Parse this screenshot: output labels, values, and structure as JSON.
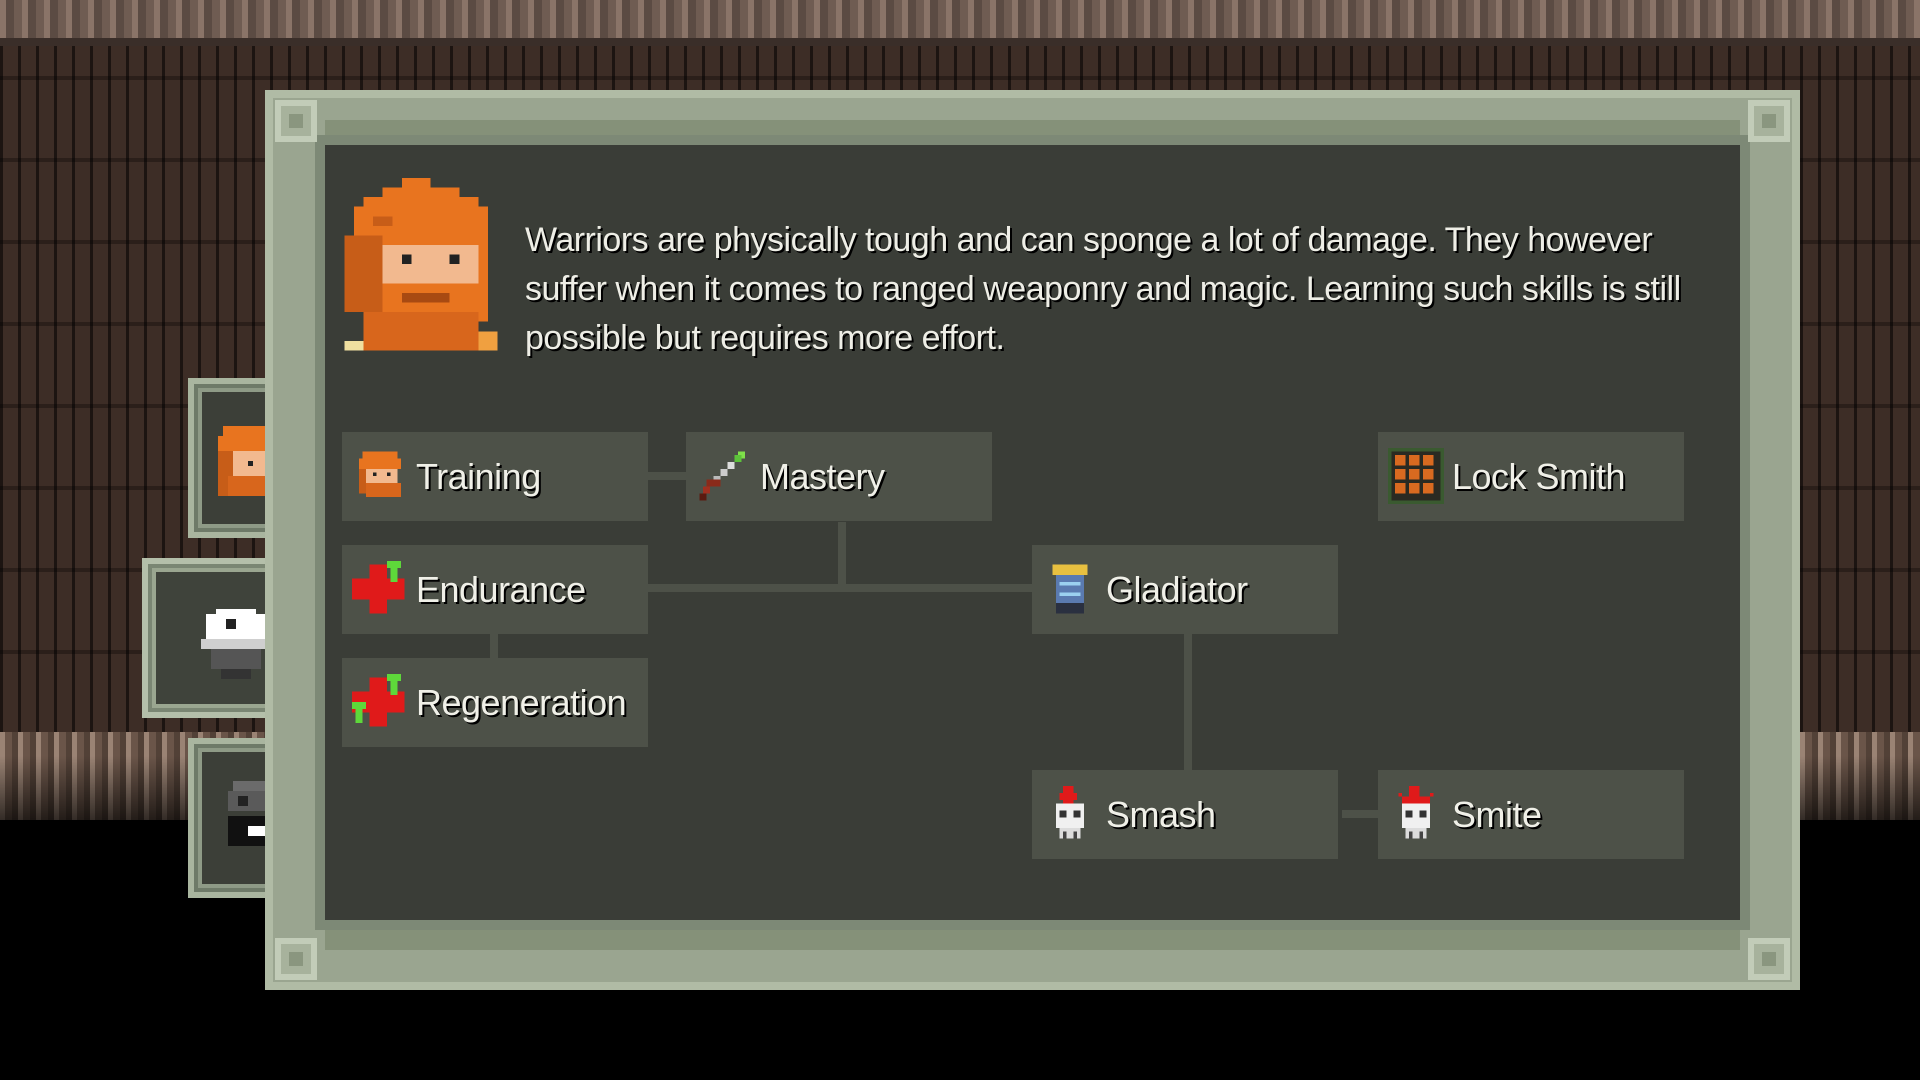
{
  "class": {
    "description": "Warriors are physically tough and can sponge a lot of damage. They however suffer when it comes to ranged weaponry and magic. Learning such skills is still possible but requires more effort.",
    "portrait_icon": "warrior-portrait-icon"
  },
  "class_tabs": [
    {
      "icon": "warrior-face-icon"
    },
    {
      "icon": "white-helmet-icon"
    },
    {
      "icon": "dark-helmet-icon"
    }
  ],
  "skills": {
    "training": {
      "label": "Training",
      "icon": "warrior-face-icon"
    },
    "mastery": {
      "label": "Mastery",
      "icon": "sword-icon"
    },
    "lock_smith": {
      "label": "Lock Smith",
      "icon": "grate-icon"
    },
    "endurance": {
      "label": "Endurance",
      "icon": "red-cross-up-icon"
    },
    "gladiator": {
      "label": "Gladiator",
      "icon": "armor-icon"
    },
    "regeneration": {
      "label": "Regeneration",
      "icon": "red-cross-double-up-icon"
    },
    "smash": {
      "label": "Smash",
      "icon": "skull-icon"
    },
    "smite": {
      "label": "Smite",
      "icon": "skull-icon"
    }
  },
  "colors": {
    "panel_frame": "#9aa590",
    "panel_bg": "#3a3d37",
    "skill_bg": "#4d5148",
    "hair": "#e8741f"
  }
}
